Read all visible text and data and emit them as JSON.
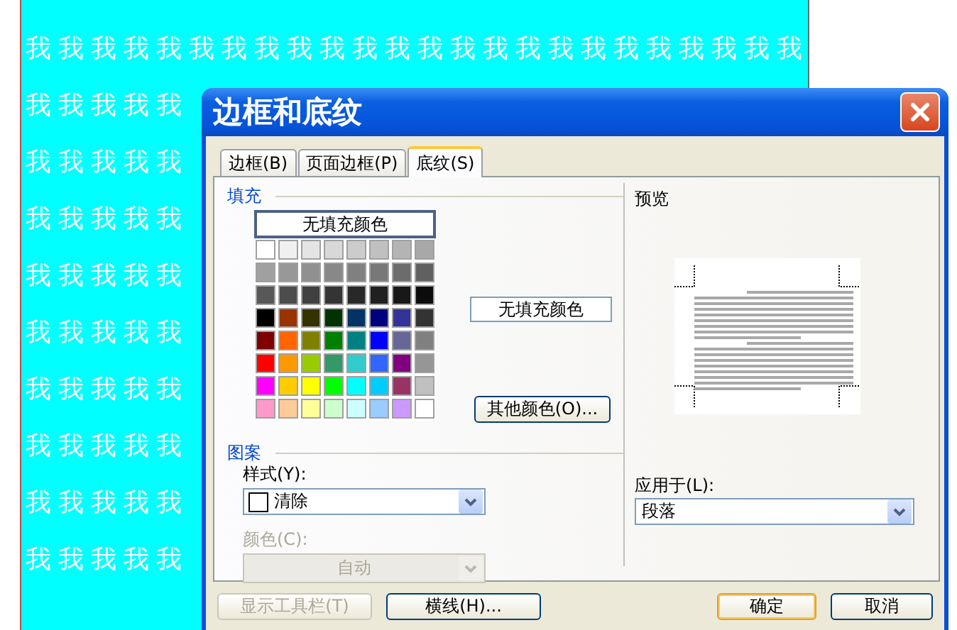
{
  "document": {
    "rows": [
      "我我我我我我我我我我我我我我我我我我我我我我我我",
      "我我我我我",
      "我我我我我",
      "我我我我我",
      "我我我我我",
      "我我我我我",
      "我我我我我",
      "我我我我我",
      "我我我我我",
      "我我我我我"
    ]
  },
  "dialog": {
    "title": "边框和底纹",
    "tabs": [
      {
        "label": "边框(B)",
        "selected": false
      },
      {
        "label": "页面边框(P)",
        "selected": false
      },
      {
        "label": "底纹(S)",
        "selected": true
      }
    ],
    "fill": {
      "label": "填充",
      "no_fill_button": "无填充颜色",
      "swatches": [
        {
          "color": "#ffffff"
        },
        {
          "color": "#f0f0f0"
        },
        {
          "color": "#e4e4e4"
        },
        {
          "color": "#d8d8d8"
        },
        {
          "color": "#cccccc"
        },
        {
          "color": "#c0c0c0"
        },
        {
          "color": "#b4b4b4"
        },
        {
          "color": "#a8a8a8"
        },
        {
          "color": "#a0a0a0"
        },
        {
          "color": "#989898"
        },
        {
          "color": "#909090"
        },
        {
          "color": "#888888"
        },
        {
          "color": "#808080"
        },
        {
          "color": "#787878"
        },
        {
          "color": "#6c6c6c"
        },
        {
          "color": "#606060"
        },
        {
          "color": "#585858"
        },
        {
          "color": "#4c4c4c"
        },
        {
          "color": "#404040"
        },
        {
          "color": "#343434"
        },
        {
          "color": "#282828"
        },
        {
          "color": "#202020"
        },
        {
          "color": "#181818"
        },
        {
          "color": "#0c0c0c"
        },
        {
          "color": "#000000"
        },
        {
          "color": "#993300"
        },
        {
          "color": "#333300"
        },
        {
          "color": "#003300"
        },
        {
          "color": "#003366"
        },
        {
          "color": "#000080"
        },
        {
          "color": "#333399"
        },
        {
          "color": "#333333"
        },
        {
          "color": "#800000"
        },
        {
          "color": "#ff6600"
        },
        {
          "color": "#808000"
        },
        {
          "color": "#008000"
        },
        {
          "color": "#008080"
        },
        {
          "color": "#0000ff"
        },
        {
          "color": "#666699"
        },
        {
          "color": "#808080"
        },
        {
          "color": "#ff0000"
        },
        {
          "color": "#ff9900"
        },
        {
          "color": "#99cc00"
        },
        {
          "color": "#339966"
        },
        {
          "color": "#33cccc"
        },
        {
          "color": "#3366ff"
        },
        {
          "color": "#800080"
        },
        {
          "color": "#969696"
        },
        {
          "color": "#ff00ff"
        },
        {
          "color": "#ffcc00"
        },
        {
          "color": "#ffff00"
        },
        {
          "color": "#00ff00"
        },
        {
          "color": "#00ffff"
        },
        {
          "color": "#00ccff"
        },
        {
          "color": "#993366"
        },
        {
          "color": "#c0c0c0"
        },
        {
          "color": "#ff99cc"
        },
        {
          "color": "#ffcc99"
        },
        {
          "color": "#ffff99"
        },
        {
          "color": "#ccffcc"
        },
        {
          "color": "#ccffff"
        },
        {
          "color": "#99ccff"
        },
        {
          "color": "#cc99ff"
        },
        {
          "color": "#ffffff"
        }
      ],
      "current": "无填充颜色",
      "more_colors_button": "其他颜色(O)..."
    },
    "pattern": {
      "label": "图案",
      "style_label": "样式(Y):",
      "style_value": "清除",
      "color_label": "颜色(C):",
      "color_value": "自动",
      "color_disabled": true
    },
    "preview": {
      "label": "预览"
    },
    "apply_to": {
      "label": "应用于(L):",
      "value": "段落"
    },
    "buttons": [
      {
        "label": "显示工具栏(T)",
        "disabled": true,
        "default": false
      },
      {
        "label": "横线(H)...",
        "disabled": false,
        "default": false
      },
      {
        "label": "确定",
        "disabled": false,
        "default": true
      },
      {
        "label": "取消",
        "disabled": false,
        "default": false
      }
    ]
  }
}
